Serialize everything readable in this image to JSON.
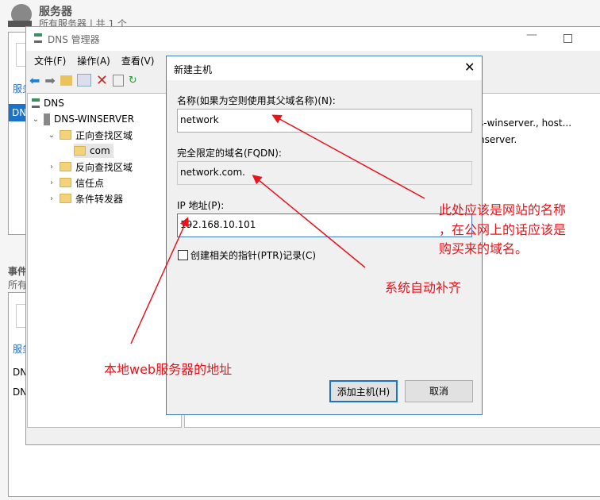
{
  "server_manager": {
    "title": "服务器",
    "subtitle": "所有服务器 | 共 1 个",
    "section_link": "服务",
    "selected_row": "DN",
    "events_title": "事件",
    "events_subtitle": "所有",
    "events_link": "服务",
    "event_rows": [
      "DN",
      "DN"
    ]
  },
  "dns_window": {
    "title": "DNS 管理器",
    "menu": [
      "文件(F)",
      "操作(A)",
      "查看(V)"
    ],
    "tree": {
      "root": "DNS",
      "server": "DNS-WINSERVER",
      "forward": "正向查找区域",
      "zone": "com",
      "reverse": "反向查找区域",
      "trust": "信任点",
      "forwarders": "条件转发器"
    },
    "right_pane": [
      "s-winserver., host...",
      "nserver."
    ]
  },
  "dialog": {
    "title": "新建主机",
    "name_label": "名称(如果为空则使用其父域名称)(N):",
    "name_value": "network",
    "fqdn_label": "完全限定的域名(FQDN):",
    "fqdn_value": "network.com.",
    "ip_label": "IP 地址(P):",
    "ip_value": "192.168.10.101",
    "ptr_label": "创建相关的指针(PTR)记录(C)",
    "ptr_checked": false,
    "add_button": "添加主机(H)",
    "cancel_button": "取消"
  },
  "annotations": {
    "name_note": [
      "此处应该是网站的名称",
      "，在公网上的话应该是",
      "购买来的域名。"
    ],
    "fqdn_note": "系统自动补齐",
    "ip_note": "本地web服务器的地址",
    "color": "#e8131b"
  }
}
